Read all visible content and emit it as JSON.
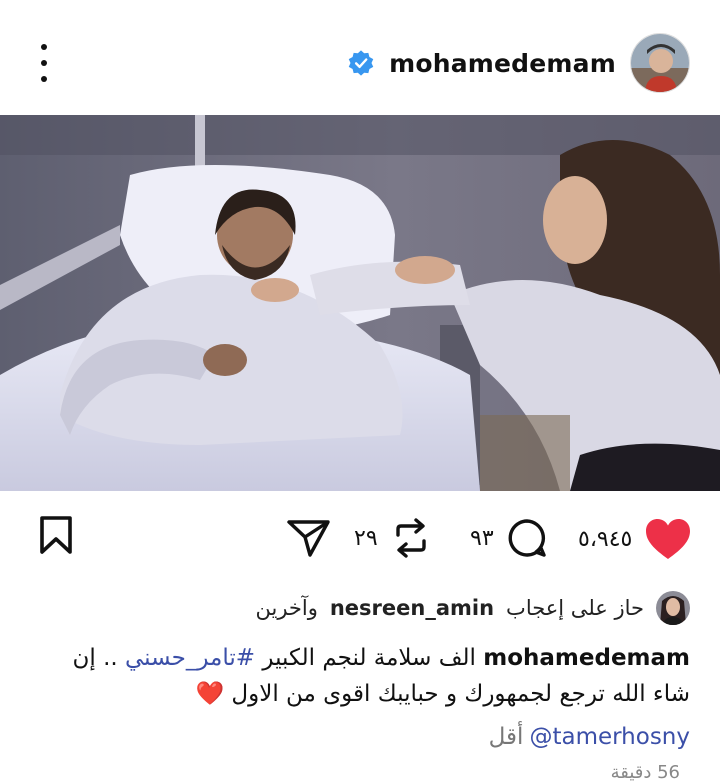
{
  "post": {
    "username": "mohamedemam",
    "verified": true
  },
  "actions": {
    "likes": "٥،٩٤٥",
    "comments": "٩٣",
    "reposts": "٢٩"
  },
  "liked_by": {
    "prefix": "حاز على إعجاب",
    "name": "nesreen_amin",
    "suffix": "وآخرين"
  },
  "caption": {
    "user": "mohamedemam",
    "text_before_tag": "الف سلامة لنجم الكبير",
    "hashtag": "#تامر_حسني",
    "text_after_tag": ".. إن شاء الله ترجع لجمهورك و حبايبك اقوى من الاول",
    "emoji": "❤️",
    "mention": "tamerhosny",
    "less_label": "أقل"
  },
  "time": "56 دقيقة",
  "colors": {
    "heart": "#ed3048",
    "verified": "#3897f0",
    "link": "#3b4fa8"
  }
}
